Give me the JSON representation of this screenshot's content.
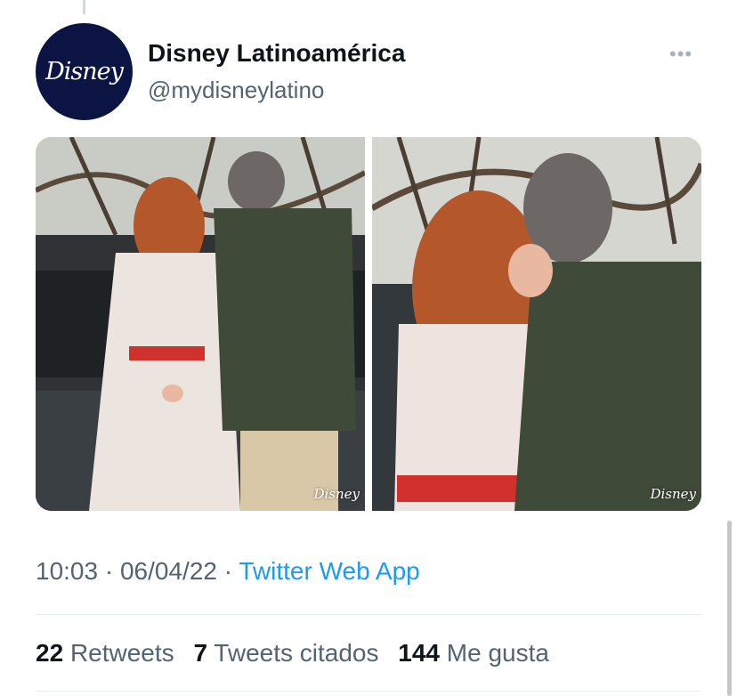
{
  "tweet": {
    "author": {
      "name": "Disney Latinoamérica",
      "handle": "@mydisneylatino",
      "avatar_logo": "Disney"
    },
    "more_icon": "more-options-icon",
    "media": [
      {
        "watermark": "Disney"
      },
      {
        "watermark": "Disney"
      }
    ],
    "time": "10:03",
    "sep1": "·",
    "date": "06/04/22",
    "sep2": "·",
    "source_app": "Twitter Web App",
    "stats": {
      "retweets_count": "22",
      "retweets_label": "Retweets",
      "quotes_count": "7",
      "quotes_label": "Tweets citados",
      "likes_count": "144",
      "likes_label": "Me gusta"
    }
  },
  "colors": {
    "avatar_bg": "#0b1442",
    "link": "#1d9bf0",
    "secondary_text": "#536471",
    "primary_text": "#0f1419"
  }
}
